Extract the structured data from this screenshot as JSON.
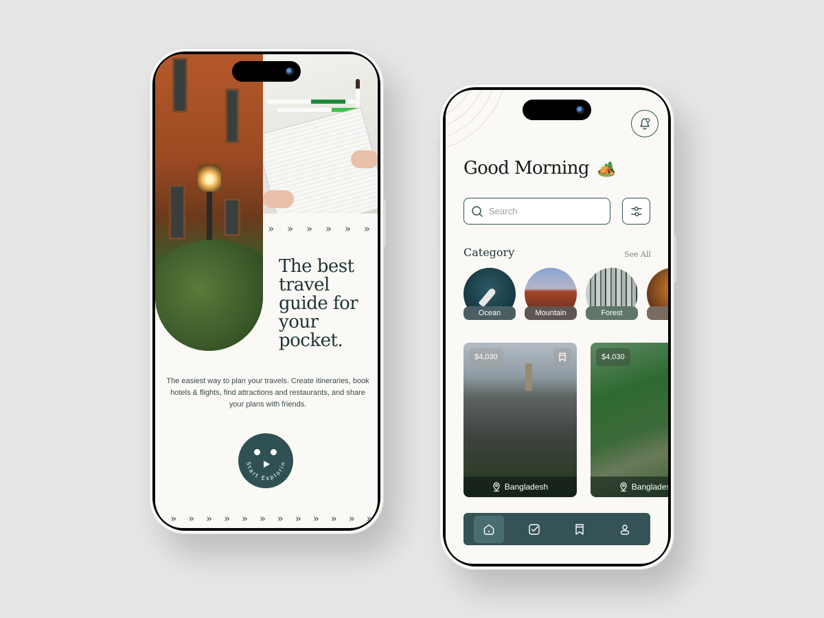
{
  "onboarding": {
    "headline": "The best travel guide for your pocket.",
    "description": "The easiest way to plan your travels. Create itineraries, book hotels & flights, find attractions and restaurants, and share your plans with friends.",
    "cta_label": "Start Exploring",
    "chevrons_top": "» » » » » » » »",
    "chevrons_bottom": "» » » » » » » » » » » » » »"
  },
  "home": {
    "greeting": "Good Morning",
    "greeting_emoji": "🏕️",
    "search_placeholder": "Search",
    "category_title": "Category",
    "see_all_label": "See All",
    "categories": [
      {
        "label": "Ocean",
        "color": "#4b5f62"
      },
      {
        "label": "Mountain",
        "color": "#5e5652"
      },
      {
        "label": "Forest",
        "color": "#5f7668"
      },
      {
        "label": "",
        "color": "#7a6a60"
      }
    ],
    "places": [
      {
        "price": "$4,030",
        "location": "Bangladesh",
        "bookmark": true
      },
      {
        "price": "$4,030",
        "location": "Bangladesh",
        "bookmark": false
      }
    ],
    "nav": [
      {
        "icon": "home-icon",
        "active": true
      },
      {
        "icon": "checkbox-icon",
        "active": false
      },
      {
        "icon": "bookmark-icon",
        "active": false
      },
      {
        "icon": "profile-icon",
        "active": false
      }
    ]
  },
  "colors": {
    "primary": "#2f5153",
    "nav_bg": "#355356",
    "screen_bg": "#fbf9f5",
    "text_dark": "#1c3336"
  }
}
